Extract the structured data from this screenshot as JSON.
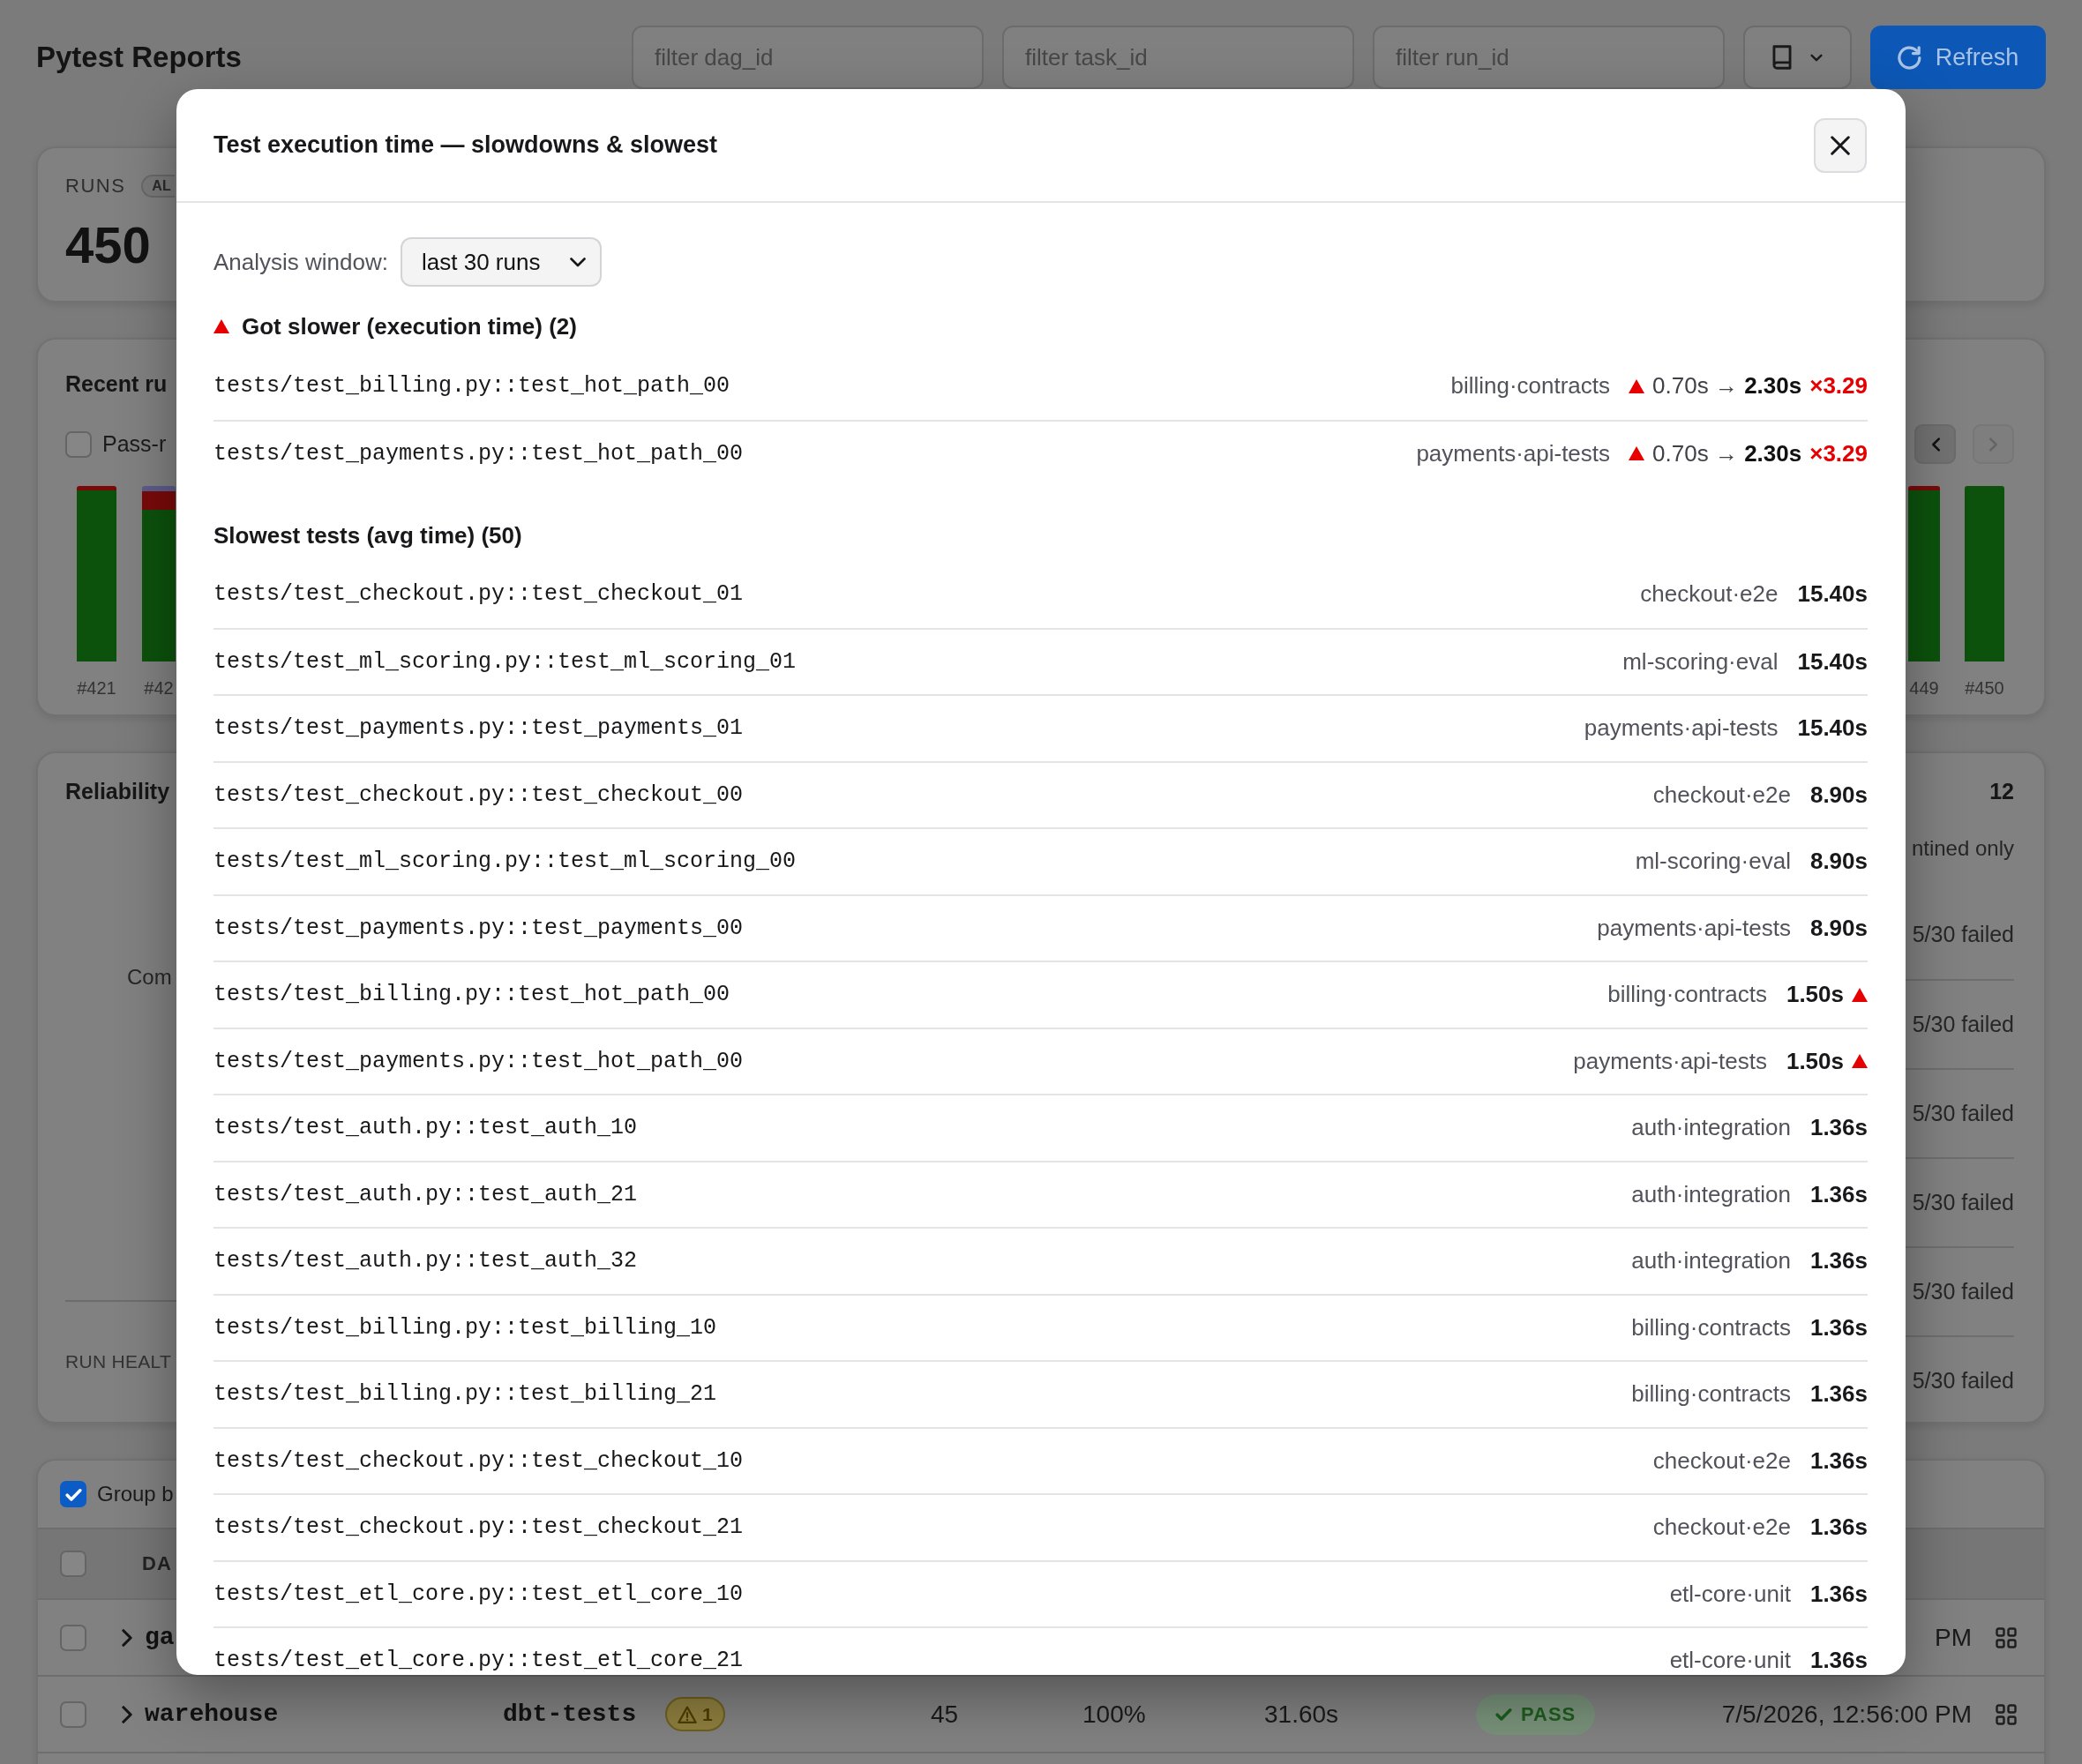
{
  "header": {
    "title": "Pytest Reports",
    "filters": [
      {
        "placeholder": "filter dag_id"
      },
      {
        "placeholder": "filter task_id"
      },
      {
        "placeholder": "filter run_id"
      }
    ],
    "refresh": "Refresh"
  },
  "stats": {
    "label": "RUNS",
    "badge": "AL",
    "value": "450"
  },
  "recent_runs": {
    "title": "Recent ru",
    "pass_filter": {
      "label": "Pass-r",
      "checked": false
    },
    "pager": [
      {
        "kind": "prev",
        "disabled": false
      },
      {
        "kind": "next",
        "disabled": true
      }
    ],
    "bars": [
      {
        "label": "#421",
        "kind": "minor_fail"
      },
      {
        "label": "#42",
        "kind": "mixed"
      },
      {
        "label": "449",
        "kind": "minor_fail"
      },
      {
        "label": "#450",
        "kind": "pass"
      }
    ]
  },
  "reliability": {
    "title": "Reliability",
    "message": "Com",
    "section_label": "RUN HEALT",
    "count": "12",
    "note": "ntined only",
    "failures": [
      "5/30 failed",
      "5/30 failed",
      "5/30 failed",
      "5/30 failed",
      "5/30 failed",
      "5/30 failed"
    ]
  },
  "table": {
    "group_by": {
      "label": "Group b",
      "checked": true
    },
    "header": {
      "checked": false,
      "column_1": "DA"
    },
    "rows": [
      {
        "checked": false,
        "expanded": false,
        "name": "ga",
        "timestamp": "PM"
      },
      {
        "checked": false,
        "expanded": false,
        "name": "warehouse",
        "task": "dbt-tests",
        "warnings": "1",
        "tests": "45",
        "pass_rate": "100%",
        "duration": "31.60s",
        "status": {
          "label": "PASS",
          "kind": "pass"
        },
        "timestamp": "7/5/2026, 12:56:00 PM"
      }
    ]
  },
  "modal": {
    "title": "Test execution time — slowdowns & slowest",
    "window": {
      "label": "Analysis window:",
      "value": "last 30 runs"
    },
    "slower": {
      "heading": "Got slower (execution time) (2)",
      "rows": [
        {
          "test": "tests/test_billing.py::test_hot_path_00",
          "suite": "billing·contracts",
          "change": "0.70s → **2.30s**",
          "ratio": "×3.29"
        },
        {
          "test": "tests/test_payments.py::test_hot_path_00",
          "suite": "payments·api-tests",
          "change": "0.70s → **2.30s**",
          "ratio": "×3.29"
        }
      ]
    },
    "slowest": {
      "heading": "Slowest tests (avg time) (50)",
      "rows": [
        {
          "test": "tests/test_checkout.py::test_checkout_01",
          "suite": "checkout·e2e",
          "time": "15.40s",
          "flagged": false
        },
        {
          "test": "tests/test_ml_scoring.py::test_ml_scoring_01",
          "suite": "ml-scoring·eval",
          "time": "15.40s",
          "flagged": false
        },
        {
          "test": "tests/test_payments.py::test_payments_01",
          "suite": "payments·api-tests",
          "time": "15.40s",
          "flagged": false
        },
        {
          "test": "tests/test_checkout.py::test_checkout_00",
          "suite": "checkout·e2e",
          "time": "8.90s",
          "flagged": false
        },
        {
          "test": "tests/test_ml_scoring.py::test_ml_scoring_00",
          "suite": "ml-scoring·eval",
          "time": "8.90s",
          "flagged": false
        },
        {
          "test": "tests/test_payments.py::test_payments_00",
          "suite": "payments·api-tests",
          "time": "8.90s",
          "flagged": false
        },
        {
          "test": "tests/test_billing.py::test_hot_path_00",
          "suite": "billing·contracts",
          "time": "1.50s",
          "flagged": true
        },
        {
          "test": "tests/test_payments.py::test_hot_path_00",
          "suite": "payments·api-tests",
          "time": "1.50s",
          "flagged": true
        },
        {
          "test": "tests/test_auth.py::test_auth_10",
          "suite": "auth·integration",
          "time": "1.36s",
          "flagged": false
        },
        {
          "test": "tests/test_auth.py::test_auth_21",
          "suite": "auth·integration",
          "time": "1.36s",
          "flagged": false
        },
        {
          "test": "tests/test_auth.py::test_auth_32",
          "suite": "auth·integration",
          "time": "1.36s",
          "flagged": false
        },
        {
          "test": "tests/test_billing.py::test_billing_10",
          "suite": "billing·contracts",
          "time": "1.36s",
          "flagged": false
        },
        {
          "test": "tests/test_billing.py::test_billing_21",
          "suite": "billing·contracts",
          "time": "1.36s",
          "flagged": false
        },
        {
          "test": "tests/test_checkout.py::test_checkout_10",
          "suite": "checkout·e2e",
          "time": "1.36s",
          "flagged": false
        },
        {
          "test": "tests/test_checkout.py::test_checkout_21",
          "suite": "checkout·e2e",
          "time": "1.36s",
          "flagged": false
        },
        {
          "test": "tests/test_etl_core.py::test_etl_core_10",
          "suite": "etl-core·unit",
          "time": "1.36s",
          "flagged": false
        },
        {
          "test": "tests/test_etl_core.py::test_etl_core_21",
          "suite": "etl-core·unit",
          "time": "1.36s",
          "flagged": false
        }
      ]
    }
  }
}
